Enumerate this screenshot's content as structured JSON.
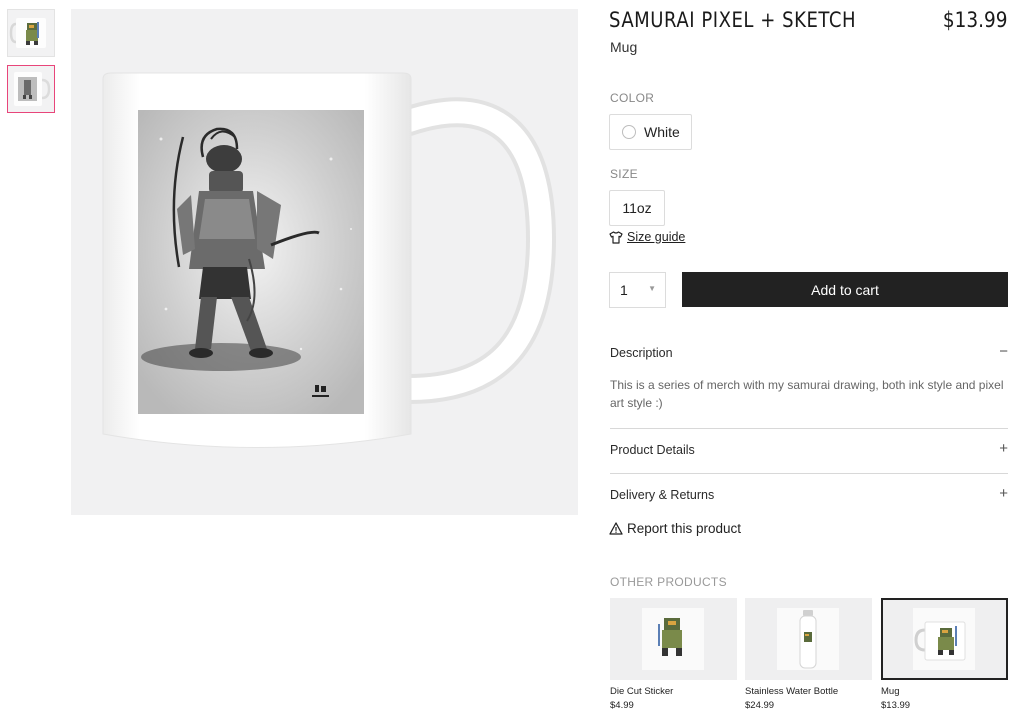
{
  "product": {
    "title": "SAMURAI PIXEL + SKETCH",
    "price": "$13.99",
    "type": "Mug"
  },
  "color": {
    "label": "COLOR",
    "selected": "White"
  },
  "size": {
    "label": "SIZE",
    "selected": "11oz",
    "guide": "Size guide"
  },
  "purchase": {
    "quantity": "1",
    "add_to_cart": "Add to cart"
  },
  "accordion": {
    "description_title": "Description",
    "description_text": "This is a series of merch with my samurai drawing, both ink style and pixel art style :)",
    "details_title": "Product Details",
    "delivery_title": "Delivery & Returns",
    "expanded_sign": "−",
    "collapsed_sign": "+"
  },
  "report": "Report this product",
  "other_products": {
    "label": "OTHER PRODUCTS",
    "items": [
      {
        "name": "Die Cut Sticker",
        "price": "$4.99"
      },
      {
        "name": "Stainless Water Bottle",
        "price": "$24.99"
      },
      {
        "name": "Mug",
        "price": "$13.99"
      }
    ]
  },
  "colors": {
    "thumb_selected_border": "#e8457a",
    "button_bg": "#222222",
    "image_bg": "#f1f1f2"
  }
}
